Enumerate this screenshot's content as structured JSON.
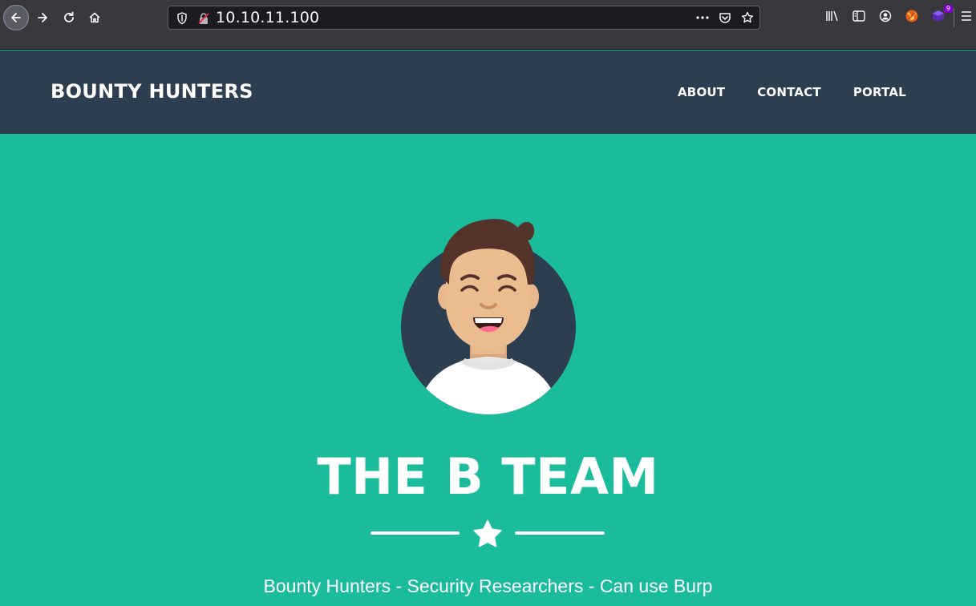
{
  "browser": {
    "url": "10.10.11.100",
    "extension_badge": "9"
  },
  "site": {
    "brand": "BOUNTY HUNTERS",
    "nav": [
      {
        "label": "ABOUT"
      },
      {
        "label": "CONTACT"
      },
      {
        "label": "PORTAL"
      }
    ]
  },
  "hero": {
    "title": "THE B TEAM",
    "subheading": "Bounty Hunters - Security Researchers - Can use Burp",
    "divider_icon": "star-icon",
    "avatar_icon": "avatar-illustration"
  },
  "colors": {
    "navbar": "#2c3e50",
    "masthead": "#1abc9c",
    "avatar_circle": "#2c3e50"
  }
}
